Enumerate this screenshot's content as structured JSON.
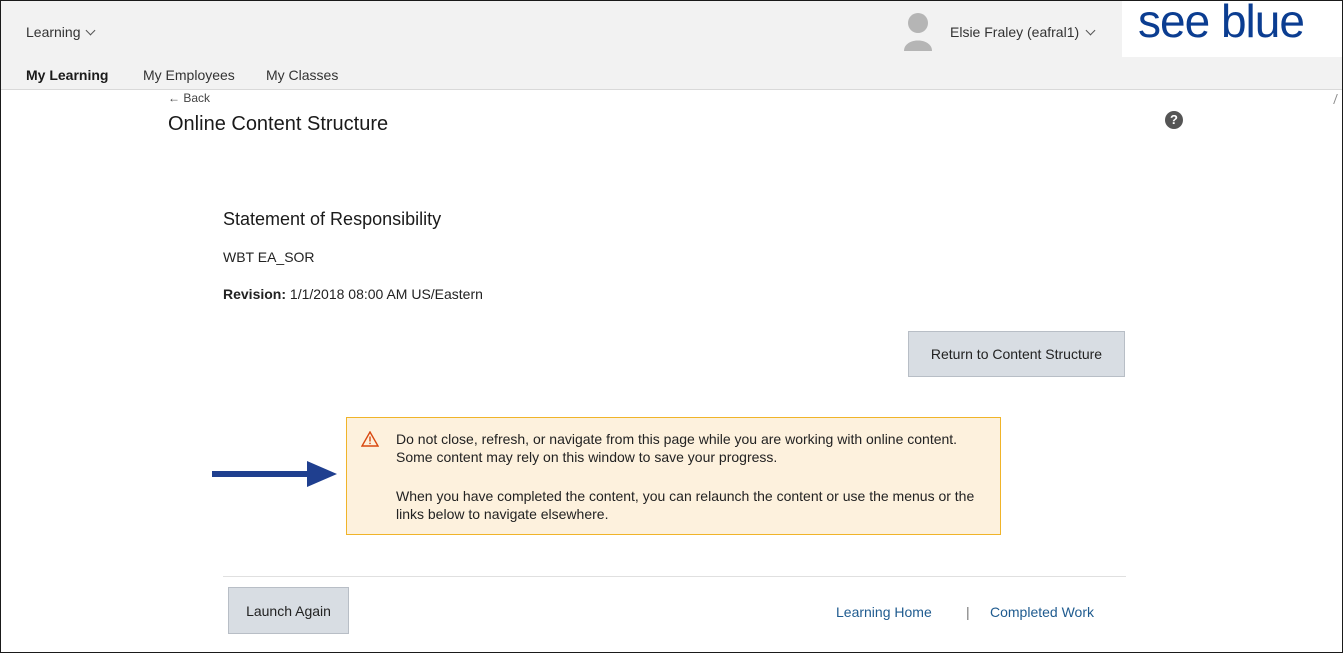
{
  "header": {
    "app_menu": "Learning",
    "user_name": "Elsie Fraley (eafral1)",
    "logo_text": "see blue",
    "brand_color": "#0b3d91"
  },
  "nav": {
    "items": [
      "My Learning",
      "My Employees",
      "My Classes"
    ],
    "active": "My Learning"
  },
  "page": {
    "back_label": "← Back",
    "title": "Online Content Structure",
    "help_label": "?"
  },
  "content": {
    "title": "Statement of Responsibility",
    "code": "WBT EA_SOR",
    "revision_label": "Revision:",
    "revision_value": "1/1/2018 08:00 AM US/Eastern",
    "return_button": "Return to Content Structure"
  },
  "warning": {
    "paragraph1": "Do not close, refresh, or navigate from this page while you are working with online content. Some content may rely on this window to save your progress.",
    "paragraph2": "When you have completed the content, you can relaunch the content or use the menus or the links below to navigate elsewhere.",
    "background_color": "#fdf1dd",
    "border_color": "#f0b429"
  },
  "footer": {
    "launch_button": "Launch Again",
    "links": [
      "Learning Home",
      "Completed Work"
    ],
    "separator": "|"
  },
  "icons": {
    "warning": "warning-triangle-icon",
    "help": "help-circle-icon",
    "arrow": "right-arrow-icon",
    "chevron": "chevron-down-icon"
  }
}
